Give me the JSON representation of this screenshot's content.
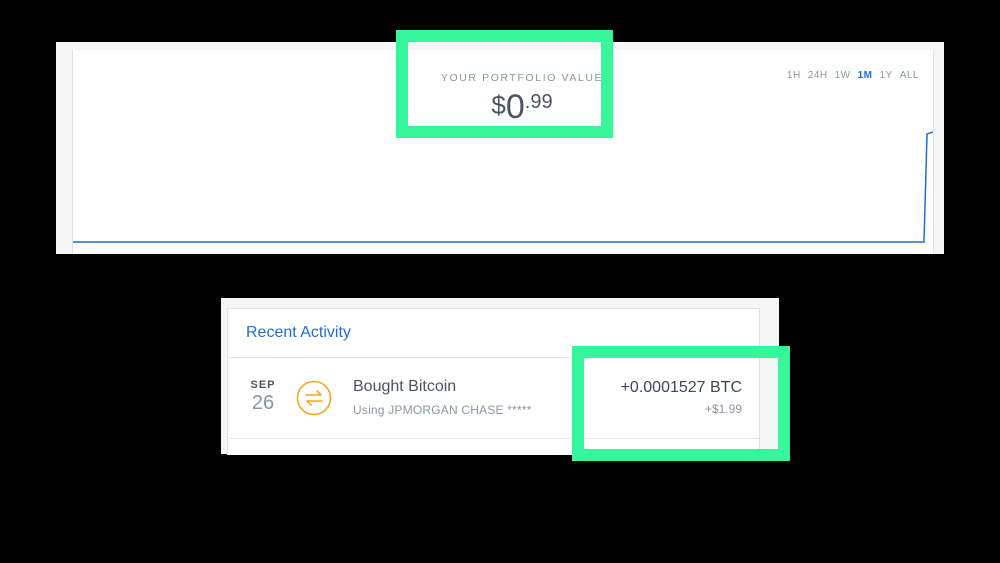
{
  "portfolio": {
    "label": "YOUR PORTFOLIO VALUE",
    "value_currency": "$",
    "value_whole": "0",
    "value_cents": ".99",
    "ranges": [
      "1H",
      "24H",
      "1W",
      "1M",
      "1Y",
      "ALL"
    ],
    "active_range": "1M",
    "line_color": "#1f6fd1"
  },
  "activity": {
    "title": "Recent Activity",
    "rows": [
      {
        "month": "SEP",
        "day": "26",
        "icon": "exchange-arrows-icon",
        "icon_color": "#f5a623",
        "title": "Bought Bitcoin",
        "subtitle": "Using JPMORGAN CHASE *****",
        "crypto_amount": "+0.0001527 BTC",
        "fiat_amount": "+$1.99"
      }
    ]
  },
  "highlight_color": "#36f59a"
}
